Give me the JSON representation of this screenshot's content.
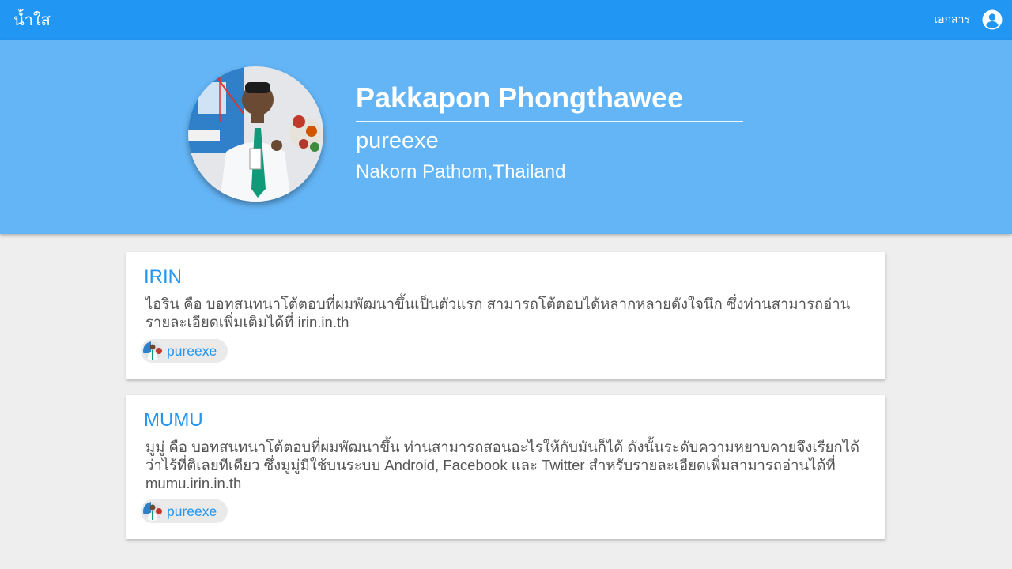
{
  "header": {
    "brand": "น้ำใส",
    "nav_docs": "เอกสาร",
    "account_icon": "account-circle-icon"
  },
  "profile": {
    "name": "Pakkapon Phongthawee",
    "username": "pureexe",
    "location": "Nakorn Pathom,Thailand"
  },
  "projects": [
    {
      "title": "IRIN",
      "description": "ไอริน คือ บอทสนทนาโต้ตอบที่ผมพัฒนาขึ้นเป็นตัวแรก สามารถโต้ตอบได้หลากหลายดังใจนึก ซึ่งท่านสามารถอ่านรายละเอียดเพิ่มเติมได้ที่ irin.in.th",
      "owner": "pureexe"
    },
    {
      "title": "MUMU",
      "description": "มูมู่ คือ บอทสนทนาโต้ตอบที่ผมพัฒนาขึ้น ท่านสามารถสอนอะไรให้กับมันก็ได้ ดังนั้นระดับความหยาบคายจึงเรียกได้ว่าไร้ที่ติเลยทีเดียว ซึ่งมูมู่มีใช้บนระบบ Android, Facebook และ Twitter สำหรับรายละเอียดเพิ่มสามารถอ่านได้ที่ mumu.irin.in.th",
      "owner": "pureexe"
    }
  ],
  "colors": {
    "primary": "#2196f3",
    "hero": "#64b5f6",
    "background": "#eeeeee"
  }
}
